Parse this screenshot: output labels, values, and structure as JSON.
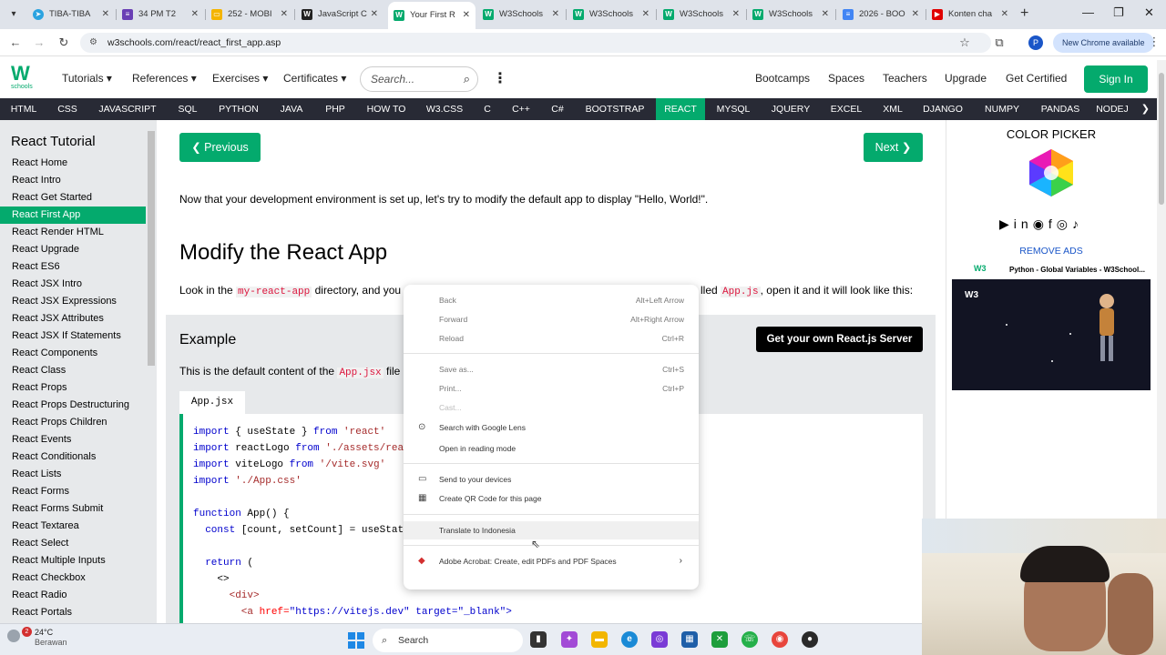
{
  "browser": {
    "tabs": [
      {
        "title": "TIBA-TIBA",
        "favicon": "telegram-icon",
        "color": "#2aa3e0"
      },
      {
        "title": "34 PM T2",
        "favicon": "form-icon",
        "color": "#6a3fb5"
      },
      {
        "title": "252 - MOBI",
        "favicon": "slides-icon",
        "color": "#f4b400"
      },
      {
        "title": "JavaScript C",
        "favicon": "w3-icon",
        "color": "#222222"
      },
      {
        "title": "Your First R",
        "favicon": "w3-icon",
        "color": "#04aa6d",
        "active": true
      },
      {
        "title": "W3Schools",
        "favicon": "w3-icon",
        "color": "#04aa6d"
      },
      {
        "title": "W3Schools",
        "favicon": "w3-icon",
        "color": "#04aa6d"
      },
      {
        "title": "W3Schools",
        "favicon": "w3-icon",
        "color": "#04aa6d"
      },
      {
        "title": "W3Schools",
        "favicon": "w3-icon",
        "color": "#04aa6d"
      },
      {
        "title": "2026 - BOO",
        "favicon": "docs-icon",
        "color": "#4285f4"
      },
      {
        "title": "Konten cha",
        "favicon": "youtube-icon",
        "color": "#e00000"
      }
    ],
    "url": "w3schools.com/react/react_first_app.asp",
    "profile_initial": "P",
    "new_chrome": "New Chrome available"
  },
  "header": {
    "logo_text": "W",
    "logo_sub": "schools",
    "nav": [
      "Tutorials",
      "References",
      "Exercises",
      "Certificates"
    ],
    "search_placeholder": "Search...",
    "right_links": [
      "Bootcamps",
      "Spaces",
      "Teachers",
      "Upgrade",
      "Get Certified"
    ],
    "signin": "Sign In"
  },
  "topics": {
    "items": [
      "HTML",
      "CSS",
      "JAVASCRIPT",
      "SQL",
      "PYTHON",
      "JAVA",
      "PHP",
      "HOW TO",
      "W3.CSS",
      "C",
      "C++",
      "C#",
      "BOOTSTRAP",
      "REACT",
      "MYSQL",
      "JQUERY",
      "EXCEL",
      "XML",
      "DJANGO",
      "NUMPY",
      "PANDAS",
      "NODEJ"
    ],
    "active": "REACT"
  },
  "sidebar": {
    "title": "React Tutorial",
    "items": [
      "React Home",
      "React Intro",
      "React Get Started",
      "React First App",
      "React Render HTML",
      "React Upgrade",
      "React ES6",
      "React JSX Intro",
      "React JSX Expressions",
      "React JSX Attributes",
      "React JSX If Statements",
      "React Components",
      "React Class",
      "React Props",
      "React Props Destructuring",
      "React Props Children",
      "React Events",
      "React Conditionals",
      "React Lists",
      "React Forms",
      "React Forms Submit",
      "React Textarea",
      "React Select",
      "React Multiple Inputs",
      "React Checkbox",
      "React Radio",
      "React Portals"
    ],
    "active": "React First App"
  },
  "main": {
    "prev": "❮ Previous",
    "next": "Next ❯",
    "intro": "Now that your development environment is set up, let's try to modify the default app to display \"Hello, World!\".",
    "heading": "Modify the React App",
    "look_a": "Look in the ",
    "look_code1": "my-react-app",
    "look_b": " directory, and you",
    "look_c": "lled ",
    "look_code2": "App.js",
    "look_d": ", open it and it will look like this:",
    "example": {
      "title": "Example",
      "server_button": "Get your own React.js Server",
      "desc_a": "This is the default content of the ",
      "desc_code": "App.jsx",
      "desc_b": " file",
      "file_tab": "App.jsx",
      "code": [
        {
          "kw": "import",
          "rest": " { useState } ",
          "kw2": "from",
          "str": " 'react'"
        },
        {
          "kw": "import",
          "rest": " reactLogo ",
          "kw2": "from",
          "str": " './assets/rea"
        },
        {
          "kw": "import",
          "rest": " viteLogo ",
          "kw2": "from",
          "str": " '/vite.svg'"
        },
        {
          "kw": "import",
          "rest": "",
          "kw2": "",
          "str": " './App.css'"
        },
        {
          "kw": "",
          "rest": "",
          "kw2": "",
          "str": ""
        },
        {
          "kw": "function",
          "rest": " App() {",
          "kw2": "",
          "str": ""
        },
        {
          "kw": "  const",
          "rest": " [count, setCount] = useStat",
          "kw2": "",
          "str": ""
        },
        {
          "kw": "",
          "rest": "",
          "kw2": "",
          "str": ""
        },
        {
          "kw": "  return",
          "rest": " (",
          "kw2": "",
          "str": ""
        },
        {
          "kw": "",
          "rest": "    <>",
          "kw2": "",
          "str": ""
        },
        {
          "kw": "",
          "rest": "      <div>",
          "kw2": "",
          "str": ""
        },
        {
          "kw": "",
          "rest": "        <a ",
          "kw2": "href=",
          "str": "\"https://vitejs.dev\" target=\"_blank\">"
        }
      ]
    }
  },
  "right": {
    "color_picker": "COLOR PICKER",
    "remove_ads": "REMOVE ADS",
    "ad_line": "Python - Global Variables - W3School...",
    "ad_logo": "W3"
  },
  "context_menu": {
    "items": [
      {
        "label": "Back",
        "shortcut": "Alt+Left Arrow"
      },
      {
        "label": "Forward",
        "shortcut": "Alt+Right Arrow"
      },
      {
        "label": "Reload",
        "shortcut": "Ctrl+R"
      },
      {
        "label": "Save as...",
        "shortcut": "Ctrl+S"
      },
      {
        "label": "Print...",
        "shortcut": "Ctrl+P"
      },
      {
        "label": "Cast...",
        "shortcut": ""
      },
      {
        "label": "Search with Google Lens",
        "shortcut": ""
      },
      {
        "label": "Open in reading mode",
        "shortcut": ""
      },
      {
        "label": "Send to your devices",
        "shortcut": ""
      },
      {
        "label": "Create QR Code for this page",
        "shortcut": ""
      },
      {
        "label": "Translate to Indonesia",
        "shortcut": ""
      },
      {
        "label": "Adobe Acrobat: Create, edit PDFs and PDF Spaces",
        "shortcut": ""
      }
    ]
  },
  "taskbar": {
    "weather_temp": "24°C",
    "weather_desc": "Berawan",
    "weather_badge": "2",
    "search": "Search"
  }
}
